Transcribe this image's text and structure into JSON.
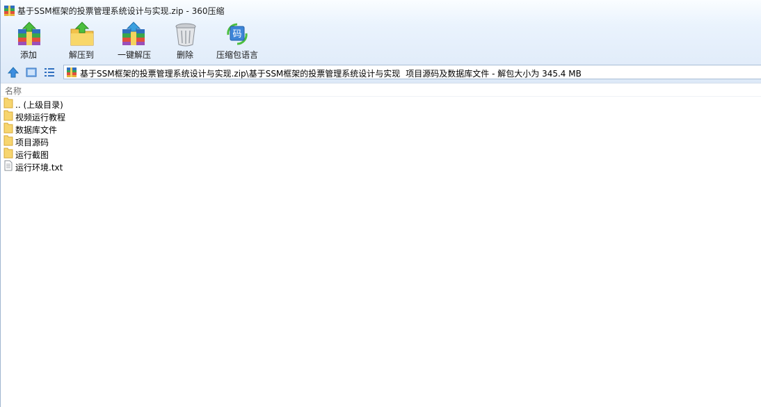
{
  "window": {
    "title": "基于SSM框架的投票管理系统设计与实现.zip - 360压缩"
  },
  "toolbar": {
    "buttons": [
      {
        "label": "添加",
        "icon": "add-archive-icon"
      },
      {
        "label": "解压到",
        "icon": "extract-to-icon"
      },
      {
        "label": "一键解压",
        "icon": "one-click-extract-icon"
      },
      {
        "label": "删除",
        "icon": "trash-can-icon"
      },
      {
        "label": "压缩包语言",
        "icon": "archive-language-icon",
        "icon_text": "码"
      }
    ]
  },
  "address": {
    "archive": "基于SSM框架的投票管理系统设计与实现.zip\\基于SSM框架的投票管理系统设计与实现",
    "info": "项目源码及数据库文件 - 解包大小为 345.4 MB"
  },
  "list": {
    "column_name": "名称",
    "items": [
      {
        "name": ".. (上级目录)",
        "type": "folder"
      },
      {
        "name": "视频运行教程",
        "type": "folder"
      },
      {
        "name": "数据库文件",
        "type": "folder"
      },
      {
        "name": "项目源码",
        "type": "folder"
      },
      {
        "name": "运行截图",
        "type": "folder"
      },
      {
        "name": "运行环境.txt",
        "type": "file"
      }
    ]
  },
  "colors": {
    "folder": "#f7d56f",
    "accent_blue": "#3d85d8",
    "chrome_top": "#fafdff",
    "chrome_bottom": "#dde9f8"
  }
}
